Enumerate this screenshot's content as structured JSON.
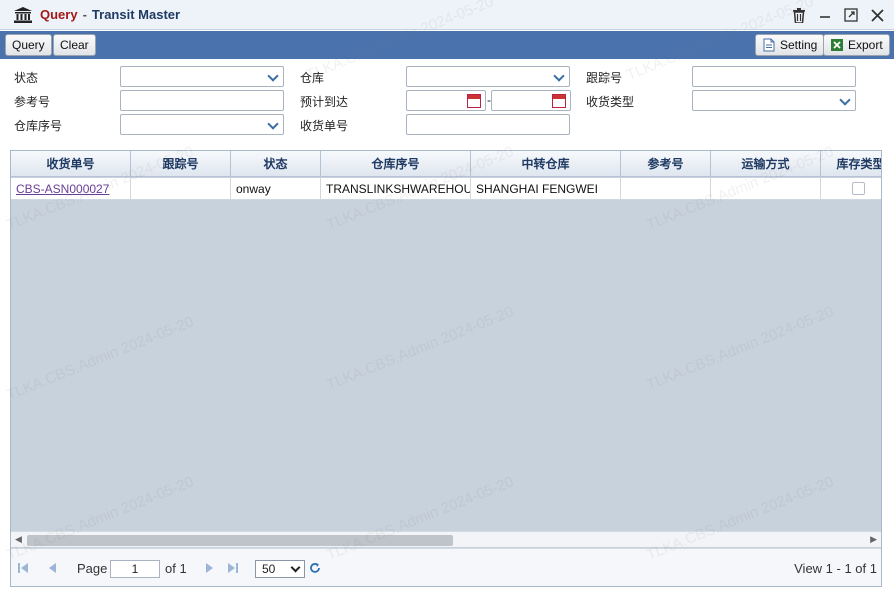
{
  "window": {
    "title_prefix": "Query",
    "title_separator": "-",
    "title_name": "Transit Master"
  },
  "toolbar": {
    "query_label": "Query",
    "clear_label": "Clear",
    "setting_label": "Setting",
    "export_label": "Export"
  },
  "filters": {
    "status_label": "状态",
    "warehouse_label": "仓库",
    "tracking_label": "跟踪号",
    "reference_label": "参考号",
    "eta_label": "预计到达",
    "eta_separator": "-",
    "receipt_type_label": "收货类型",
    "warehouse_seq_label": "仓库序号",
    "receipt_no_label": "收货单号"
  },
  "grid": {
    "columns": [
      "收货单号",
      "跟踪号",
      "状态",
      "仓库序号",
      "中转仓库",
      "参考号",
      "运输方式",
      "库存类型"
    ],
    "rows": [
      {
        "receipt_no": "CBS-ASN000027",
        "tracking": "",
        "status": "onway",
        "warehouse_seq": "TRANSLINKSHWAREHOUSE",
        "transit_warehouse": "SHANGHAI FENGWEI",
        "reference": "",
        "transport": "",
        "stock_type_checked": false
      }
    ]
  },
  "pager": {
    "page_label": "Page",
    "page_value": "1",
    "of_label": "of 1",
    "page_size": "50",
    "view_text": "View 1 - 1 of 1"
  },
  "watermark": "TLKA.CBS.Admin 2024-05-20",
  "colors": {
    "toolbar_bg": "#4a73ad",
    "title_accent": "#a31818",
    "grid_empty_bg": "#c8d2dc",
    "link": "#6a3d99"
  }
}
